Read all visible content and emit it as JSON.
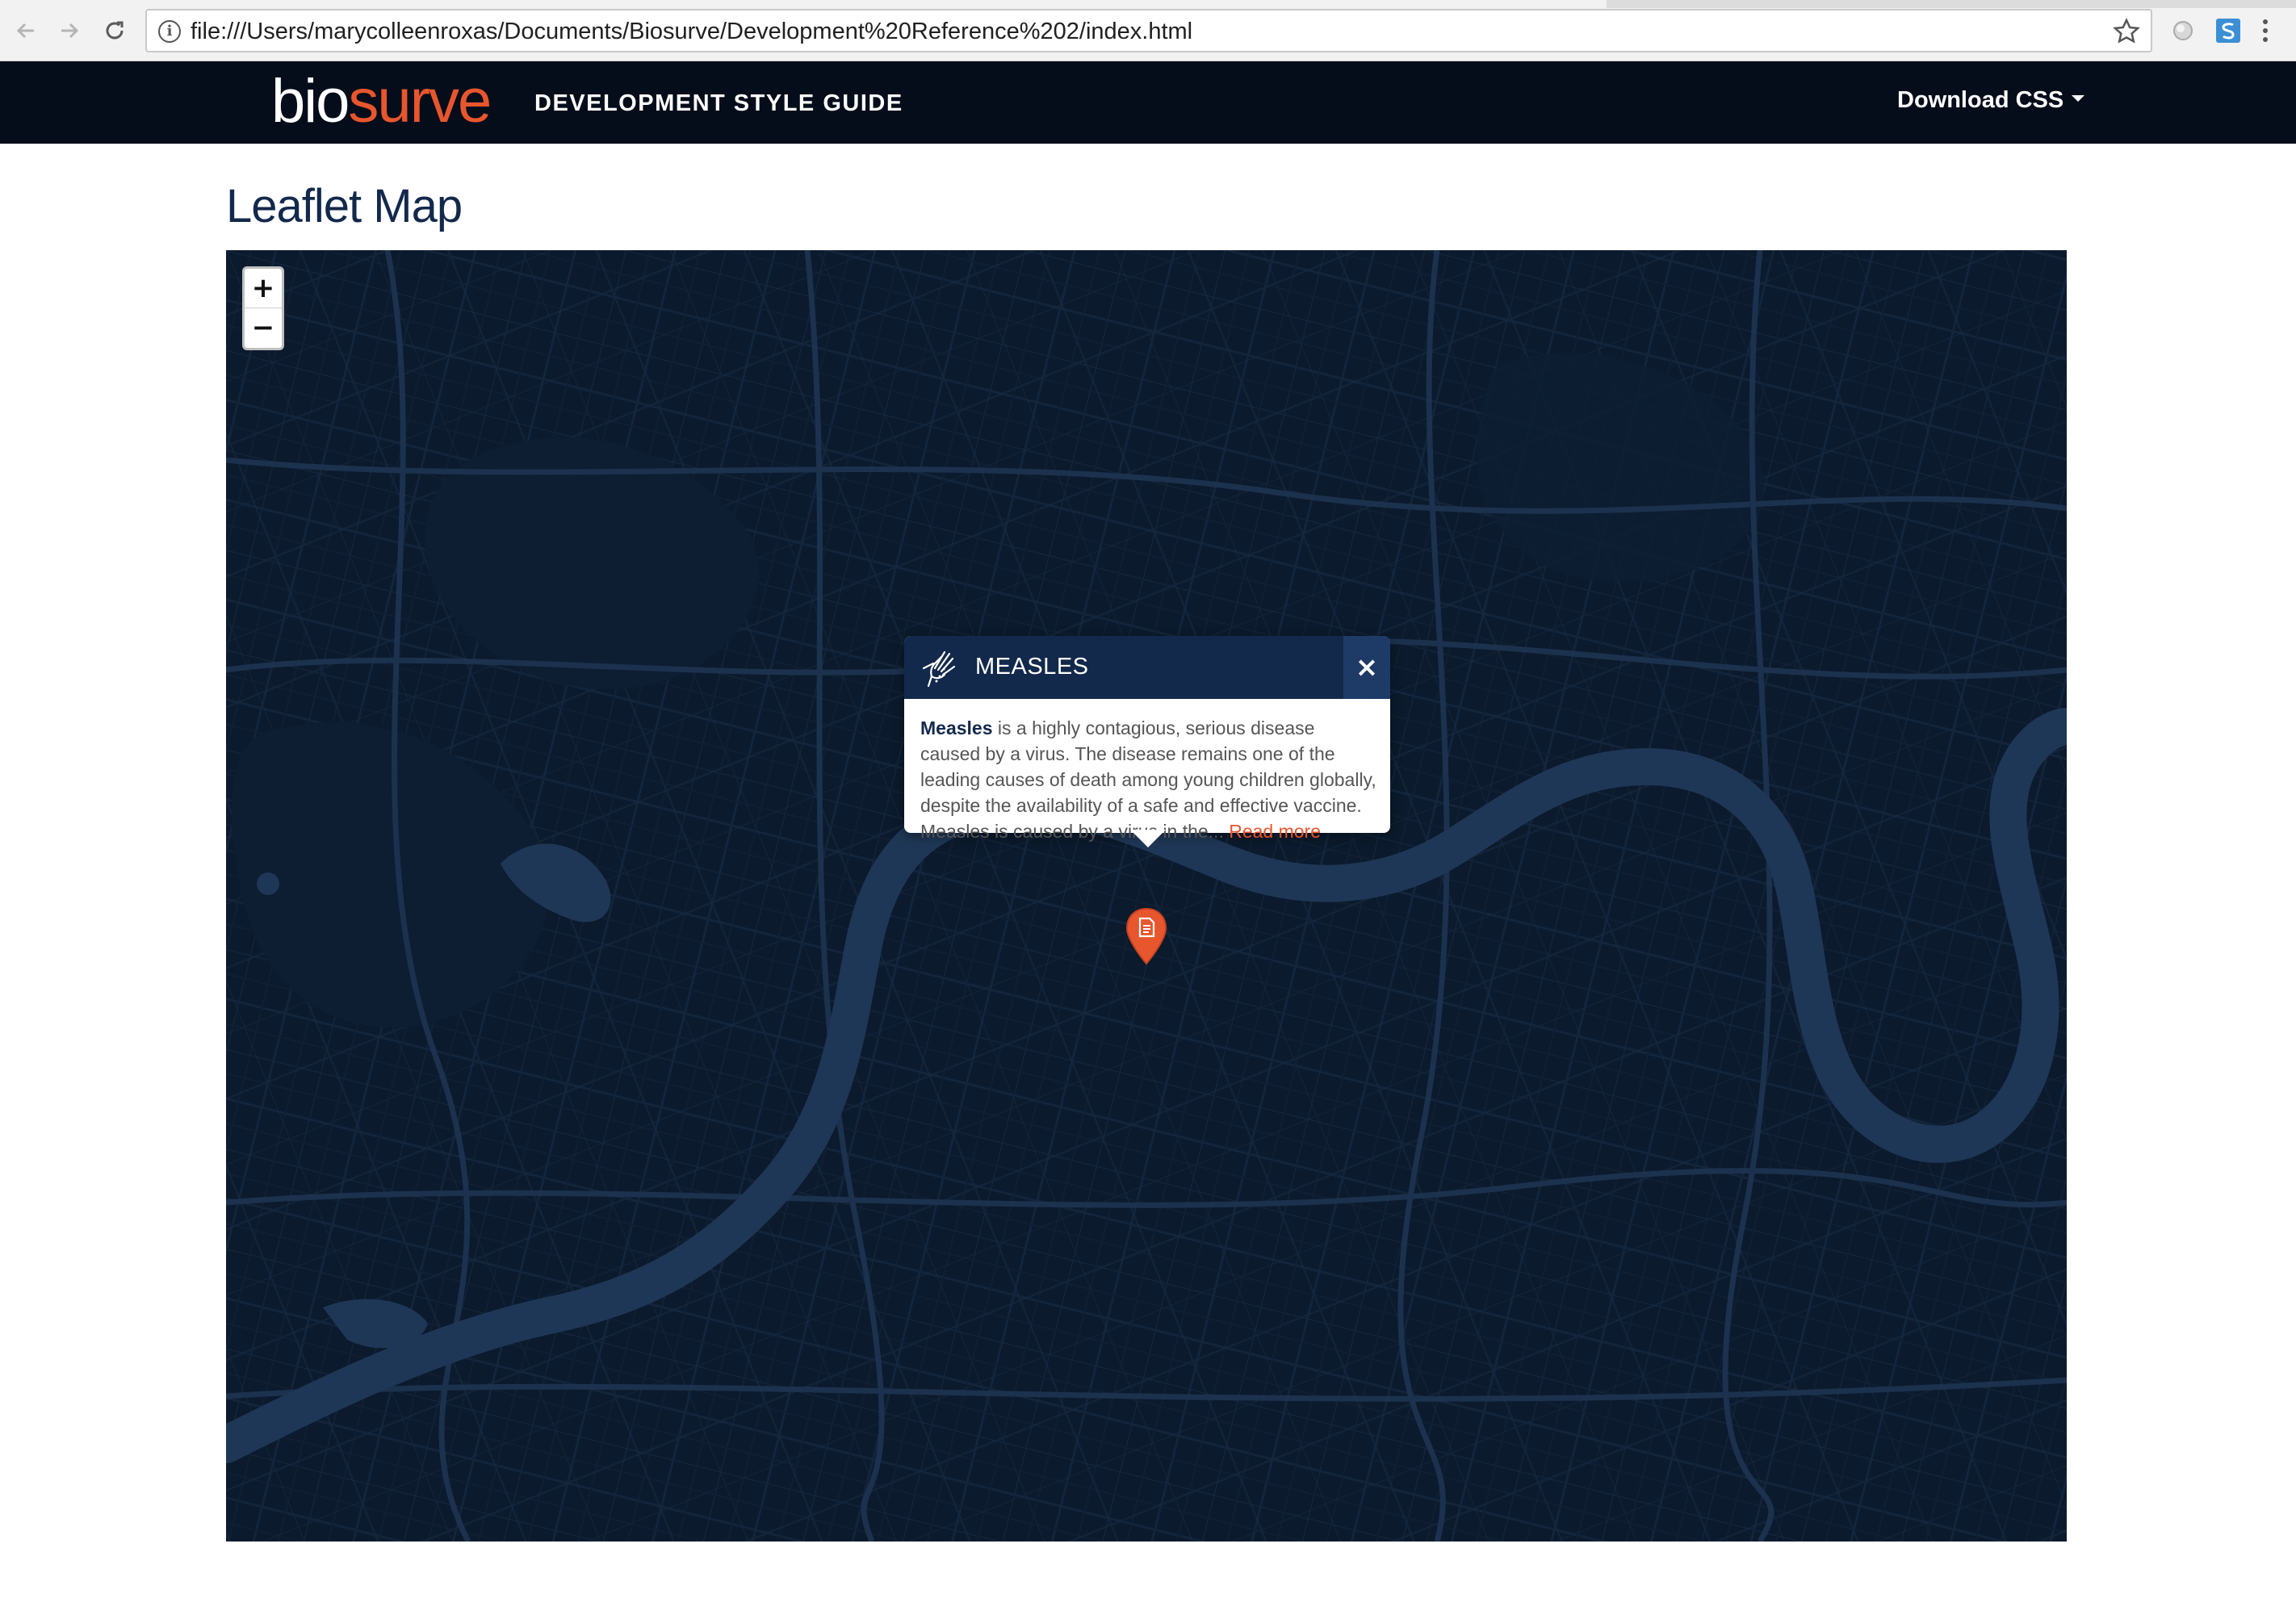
{
  "browser": {
    "url": "file:///Users/marycolleenroxas/Documents/Biosurve/Development%20Reference%202/index.html"
  },
  "navbar": {
    "logo_part1": "bio",
    "logo_part2": "surve",
    "brand_title": "DEVELOPMENT STYLE GUIDE",
    "download_label": "Download CSS"
  },
  "page": {
    "title": "Leaflet Map"
  },
  "map": {
    "zoom_in_label": "+",
    "zoom_out_label": "−",
    "background_color": "#0b1a2c",
    "popup": {
      "title": "MEASLES",
      "close_label": "×",
      "body_strong": "Measles",
      "body_text": " is a highly contagious, serious disease caused by a virus. The disease remains one of the leading causes of death among young children globally, despite the availability of a safe and effective vaccine. Measles is caused by a virus in the... ",
      "read_more_label": "Read more"
    },
    "marker_color": "#e8562e"
  },
  "colors": {
    "brand_navy": "#13294b",
    "brand_orange": "#e8562e",
    "navbar_bg": "#050d1a"
  }
}
